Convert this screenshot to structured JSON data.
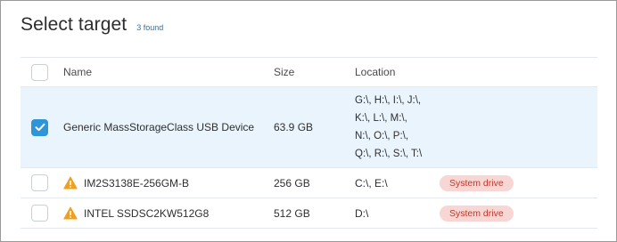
{
  "dialog": {
    "title": "Select target",
    "found": "3 found"
  },
  "table": {
    "headers": {
      "name": "Name",
      "size": "Size",
      "location": "Location"
    },
    "rows": [
      {
        "checked": true,
        "name": "Generic MassStorageClass USB Device",
        "size": "63.9 GB",
        "location_lines": [
          "G:\\, H:\\, I:\\, J:\\,",
          "K:\\, L:\\, M:\\,",
          "N:\\, O:\\, P:\\,",
          "Q:\\, R:\\, S:\\, T:\\"
        ],
        "badge": ""
      },
      {
        "checked": false,
        "warning": true,
        "name": "IM2S3138E-256GM-B",
        "size": "256 GB",
        "location": "C:\\, E:\\",
        "badge": "System drive"
      },
      {
        "checked": false,
        "warning": true,
        "name": "INTEL SSDSC2KW512G8",
        "size": "512 GB",
        "location": "D:\\",
        "badge": "System drive"
      }
    ]
  },
  "colors": {
    "accent": "#2d95d8",
    "selected_row": "#e9f4fc",
    "badge_bg": "#f7d6d3",
    "badge_text": "#c0392b",
    "warning": "#f0a020"
  },
  "icons": {
    "check": "check-icon",
    "warning": "warning-icon"
  }
}
